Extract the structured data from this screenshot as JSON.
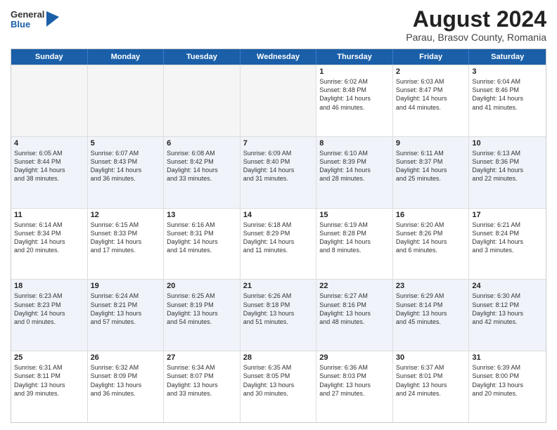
{
  "logo": {
    "general": "General",
    "blue": "Blue"
  },
  "title": "August 2024",
  "subtitle": "Parau, Brasov County, Romania",
  "header_days": [
    "Sunday",
    "Monday",
    "Tuesday",
    "Wednesday",
    "Thursday",
    "Friday",
    "Saturday"
  ],
  "weeks": [
    {
      "alt": false,
      "cells": [
        {
          "day": "",
          "lines": []
        },
        {
          "day": "",
          "lines": []
        },
        {
          "day": "",
          "lines": []
        },
        {
          "day": "",
          "lines": []
        },
        {
          "day": "1",
          "lines": [
            "Sunrise: 6:02 AM",
            "Sunset: 8:48 PM",
            "Daylight: 14 hours",
            "and 46 minutes."
          ]
        },
        {
          "day": "2",
          "lines": [
            "Sunrise: 6:03 AM",
            "Sunset: 8:47 PM",
            "Daylight: 14 hours",
            "and 44 minutes."
          ]
        },
        {
          "day": "3",
          "lines": [
            "Sunrise: 6:04 AM",
            "Sunset: 8:46 PM",
            "Daylight: 14 hours",
            "and 41 minutes."
          ]
        }
      ]
    },
    {
      "alt": true,
      "cells": [
        {
          "day": "4",
          "lines": [
            "Sunrise: 6:05 AM",
            "Sunset: 8:44 PM",
            "Daylight: 14 hours",
            "and 38 minutes."
          ]
        },
        {
          "day": "5",
          "lines": [
            "Sunrise: 6:07 AM",
            "Sunset: 8:43 PM",
            "Daylight: 14 hours",
            "and 36 minutes."
          ]
        },
        {
          "day": "6",
          "lines": [
            "Sunrise: 6:08 AM",
            "Sunset: 8:42 PM",
            "Daylight: 14 hours",
            "and 33 minutes."
          ]
        },
        {
          "day": "7",
          "lines": [
            "Sunrise: 6:09 AM",
            "Sunset: 8:40 PM",
            "Daylight: 14 hours",
            "and 31 minutes."
          ]
        },
        {
          "day": "8",
          "lines": [
            "Sunrise: 6:10 AM",
            "Sunset: 8:39 PM",
            "Daylight: 14 hours",
            "and 28 minutes."
          ]
        },
        {
          "day": "9",
          "lines": [
            "Sunrise: 6:11 AM",
            "Sunset: 8:37 PM",
            "Daylight: 14 hours",
            "and 25 minutes."
          ]
        },
        {
          "day": "10",
          "lines": [
            "Sunrise: 6:13 AM",
            "Sunset: 8:36 PM",
            "Daylight: 14 hours",
            "and 22 minutes."
          ]
        }
      ]
    },
    {
      "alt": false,
      "cells": [
        {
          "day": "11",
          "lines": [
            "Sunrise: 6:14 AM",
            "Sunset: 8:34 PM",
            "Daylight: 14 hours",
            "and 20 minutes."
          ]
        },
        {
          "day": "12",
          "lines": [
            "Sunrise: 6:15 AM",
            "Sunset: 8:33 PM",
            "Daylight: 14 hours",
            "and 17 minutes."
          ]
        },
        {
          "day": "13",
          "lines": [
            "Sunrise: 6:16 AM",
            "Sunset: 8:31 PM",
            "Daylight: 14 hours",
            "and 14 minutes."
          ]
        },
        {
          "day": "14",
          "lines": [
            "Sunrise: 6:18 AM",
            "Sunset: 8:29 PM",
            "Daylight: 14 hours",
            "and 11 minutes."
          ]
        },
        {
          "day": "15",
          "lines": [
            "Sunrise: 6:19 AM",
            "Sunset: 8:28 PM",
            "Daylight: 14 hours",
            "and 8 minutes."
          ]
        },
        {
          "day": "16",
          "lines": [
            "Sunrise: 6:20 AM",
            "Sunset: 8:26 PM",
            "Daylight: 14 hours",
            "and 6 minutes."
          ]
        },
        {
          "day": "17",
          "lines": [
            "Sunrise: 6:21 AM",
            "Sunset: 8:24 PM",
            "Daylight: 14 hours",
            "and 3 minutes."
          ]
        }
      ]
    },
    {
      "alt": true,
      "cells": [
        {
          "day": "18",
          "lines": [
            "Sunrise: 6:23 AM",
            "Sunset: 8:23 PM",
            "Daylight: 14 hours",
            "and 0 minutes."
          ]
        },
        {
          "day": "19",
          "lines": [
            "Sunrise: 6:24 AM",
            "Sunset: 8:21 PM",
            "Daylight: 13 hours",
            "and 57 minutes."
          ]
        },
        {
          "day": "20",
          "lines": [
            "Sunrise: 6:25 AM",
            "Sunset: 8:19 PM",
            "Daylight: 13 hours",
            "and 54 minutes."
          ]
        },
        {
          "day": "21",
          "lines": [
            "Sunrise: 6:26 AM",
            "Sunset: 8:18 PM",
            "Daylight: 13 hours",
            "and 51 minutes."
          ]
        },
        {
          "day": "22",
          "lines": [
            "Sunrise: 6:27 AM",
            "Sunset: 8:16 PM",
            "Daylight: 13 hours",
            "and 48 minutes."
          ]
        },
        {
          "day": "23",
          "lines": [
            "Sunrise: 6:29 AM",
            "Sunset: 8:14 PM",
            "Daylight: 13 hours",
            "and 45 minutes."
          ]
        },
        {
          "day": "24",
          "lines": [
            "Sunrise: 6:30 AM",
            "Sunset: 8:12 PM",
            "Daylight: 13 hours",
            "and 42 minutes."
          ]
        }
      ]
    },
    {
      "alt": false,
      "cells": [
        {
          "day": "25",
          "lines": [
            "Sunrise: 6:31 AM",
            "Sunset: 8:11 PM",
            "Daylight: 13 hours",
            "and 39 minutes."
          ]
        },
        {
          "day": "26",
          "lines": [
            "Sunrise: 6:32 AM",
            "Sunset: 8:09 PM",
            "Daylight: 13 hours",
            "and 36 minutes."
          ]
        },
        {
          "day": "27",
          "lines": [
            "Sunrise: 6:34 AM",
            "Sunset: 8:07 PM",
            "Daylight: 13 hours",
            "and 33 minutes."
          ]
        },
        {
          "day": "28",
          "lines": [
            "Sunrise: 6:35 AM",
            "Sunset: 8:05 PM",
            "Daylight: 13 hours",
            "and 30 minutes."
          ]
        },
        {
          "day": "29",
          "lines": [
            "Sunrise: 6:36 AM",
            "Sunset: 8:03 PM",
            "Daylight: 13 hours",
            "and 27 minutes."
          ]
        },
        {
          "day": "30",
          "lines": [
            "Sunrise: 6:37 AM",
            "Sunset: 8:01 PM",
            "Daylight: 13 hours",
            "and 24 minutes."
          ]
        },
        {
          "day": "31",
          "lines": [
            "Sunrise: 6:39 AM",
            "Sunset: 8:00 PM",
            "Daylight: 13 hours",
            "and 20 minutes."
          ]
        }
      ]
    }
  ]
}
